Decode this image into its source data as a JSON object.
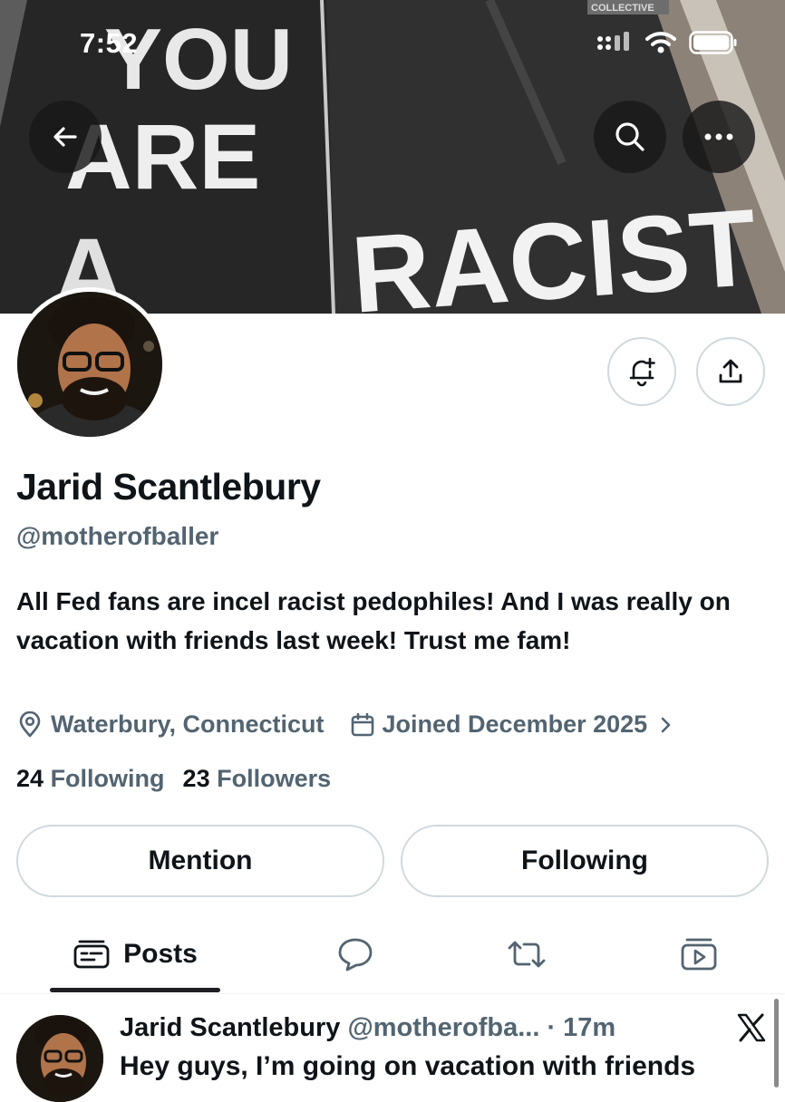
{
  "status_bar": {
    "time": "7:52"
  },
  "banner": {
    "text_lines": [
      "YOU",
      "ARE",
      "A",
      "RACIST"
    ],
    "corner_label": "COLLECTIVE"
  },
  "profile": {
    "name": "Jarid Scantlebury",
    "handle": "@motherofballer",
    "bio": "All Fed fans are incel racist pedophiles! And I was really on vacation with friends last week! Trust me fam!",
    "location": "Waterbury, Connecticut",
    "joined": "Joined December 2025",
    "following_count": "24",
    "following_label": "Following",
    "followers_count": "23",
    "followers_label": "Followers"
  },
  "actions": {
    "mention_label": "Mention",
    "following_label": "Following"
  },
  "tabs": [
    {
      "label": "Posts",
      "icon": "posts-icon",
      "active": true
    },
    {
      "label": "",
      "icon": "replies-icon",
      "active": false
    },
    {
      "label": "",
      "icon": "reposts-icon",
      "active": false
    },
    {
      "label": "",
      "icon": "media-icon",
      "active": false
    }
  ],
  "post": {
    "author_name": "Jarid Scantlebury",
    "author_handle": "@motherofba...",
    "time": "· 17m",
    "text": "Hey guys, I’m going on vacation with friends"
  },
  "colors": {
    "text": "#0f1419",
    "muted": "#536471",
    "border": "#cfd9de",
    "banner_dark": "#2b2b2b"
  }
}
